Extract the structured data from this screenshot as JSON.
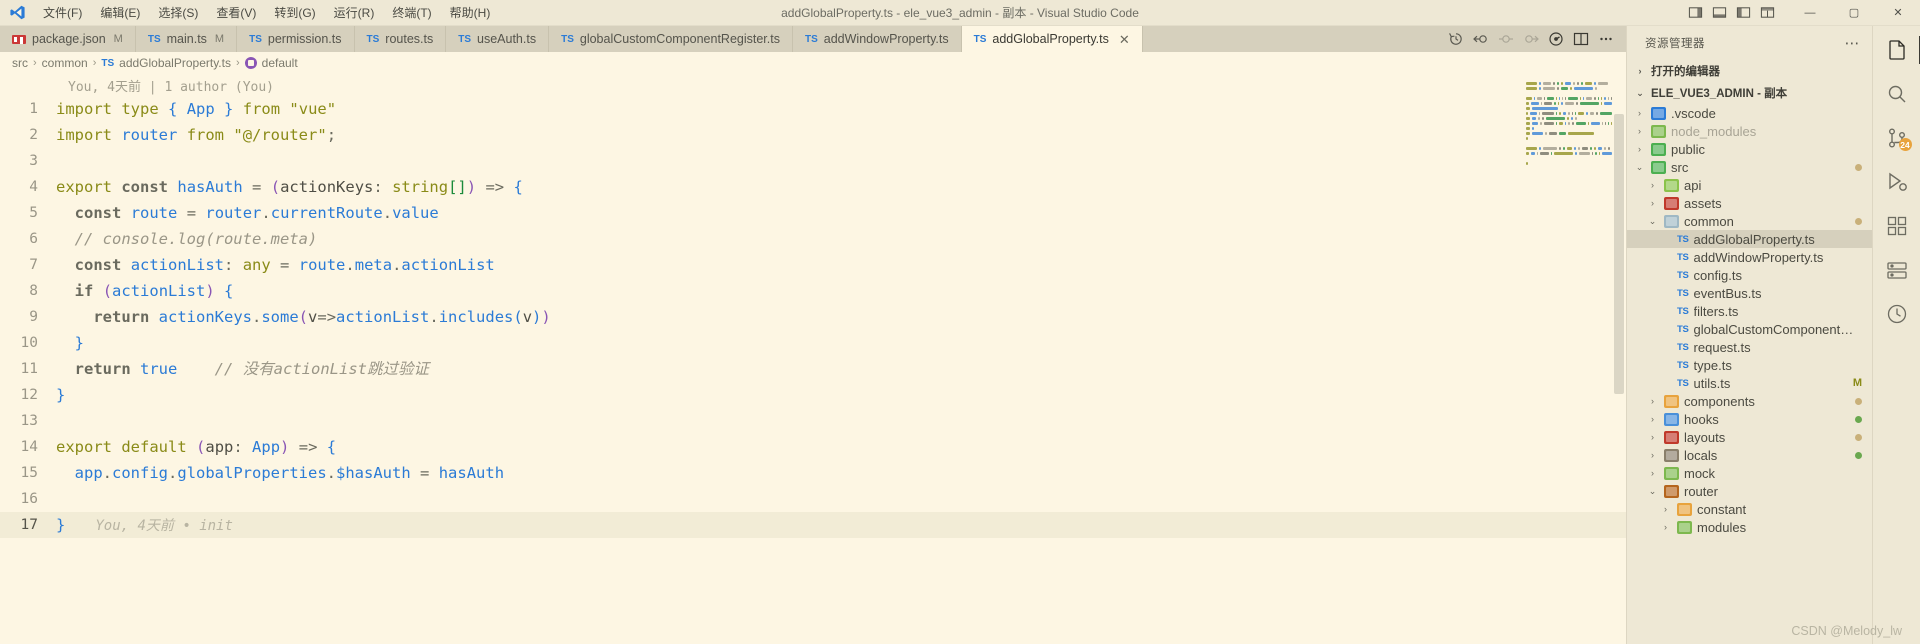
{
  "window": {
    "title": "addGlobalProperty.ts - ele_vue3_admin - 副本 - Visual Studio Code",
    "minimize": "—",
    "maximize": "▢",
    "close": "✕"
  },
  "menu": {
    "items": [
      {
        "label": "文件(F)"
      },
      {
        "label": "编辑(E)"
      },
      {
        "label": "选择(S)"
      },
      {
        "label": "查看(V)"
      },
      {
        "label": "转到(G)"
      },
      {
        "label": "运行(R)"
      },
      {
        "label": "终端(T)"
      },
      {
        "label": "帮助(H)"
      }
    ]
  },
  "tabs": [
    {
      "label": "package.json",
      "icon": "npm-icon",
      "dirty": "M",
      "active": false
    },
    {
      "label": "main.ts",
      "icon": "typescript-icon",
      "dirty": "M",
      "active": false
    },
    {
      "label": "permission.ts",
      "icon": "typescript-icon",
      "dirty": "",
      "active": false
    },
    {
      "label": "routes.ts",
      "icon": "typescript-icon",
      "dirty": "",
      "active": false
    },
    {
      "label": "useAuth.ts",
      "icon": "typescript-icon",
      "dirty": "",
      "active": false
    },
    {
      "label": "globalCustomComponentRegister.ts",
      "icon": "typescript-icon",
      "dirty": "",
      "active": false
    },
    {
      "label": "addWindowProperty.ts",
      "icon": "typescript-icon",
      "dirty": "",
      "active": false
    },
    {
      "label": "addGlobalProperty.ts",
      "icon": "typescript-icon",
      "dirty": "",
      "active": true,
      "close": "✕"
    }
  ],
  "editor_actions": [
    {
      "name": "timeline-history-icon"
    },
    {
      "name": "go-back-icon"
    },
    {
      "name": "nav-previous-icon"
    },
    {
      "name": "nav-next-icon"
    },
    {
      "name": "run-debug-icon"
    },
    {
      "name": "split-editor-icon"
    },
    {
      "name": "more-actions-icon"
    }
  ],
  "breadcrumb": {
    "parts": [
      "src",
      "common",
      "addGlobalProperty.ts",
      "default"
    ],
    "separator": "›"
  },
  "blame": {
    "text": "You, 4天前 | 1 author (You)",
    "inline_hint": "You, 4天前 • init"
  },
  "code": {
    "lines": [
      {
        "n": "1",
        "tokens": [
          {
            "t": "import",
            "c": "t-kw"
          },
          {
            "t": " ",
            "c": "t-plain"
          },
          {
            "t": "type",
            "c": "t-kw"
          },
          {
            "t": " ",
            "c": "t-plain"
          },
          {
            "t": "{",
            "c": "t-paren2"
          },
          {
            "t": " ",
            "c": "t-plain"
          },
          {
            "t": "App",
            "c": "t-type"
          },
          {
            "t": " ",
            "c": "t-plain"
          },
          {
            "t": "}",
            "c": "t-paren2"
          },
          {
            "t": " ",
            "c": "t-plain"
          },
          {
            "t": "from",
            "c": "t-kw"
          },
          {
            "t": " ",
            "c": "t-plain"
          },
          {
            "t": "\"vue\"",
            "c": "t-str"
          }
        ]
      },
      {
        "n": "2",
        "tokens": [
          {
            "t": "import",
            "c": "t-kw"
          },
          {
            "t": " ",
            "c": "t-plain"
          },
          {
            "t": "router",
            "c": "t-var"
          },
          {
            "t": " ",
            "c": "t-plain"
          },
          {
            "t": "from",
            "c": "t-kw"
          },
          {
            "t": " ",
            "c": "t-plain"
          },
          {
            "t": "\"@/router\"",
            "c": "t-str"
          },
          {
            "t": ";",
            "c": "t-punct"
          }
        ]
      },
      {
        "n": "3",
        "tokens": []
      },
      {
        "n": "4",
        "tokens": [
          {
            "t": "export",
            "c": "t-kw"
          },
          {
            "t": " ",
            "c": "t-plain"
          },
          {
            "t": "const",
            "c": "t-kw2"
          },
          {
            "t": " ",
            "c": "t-plain"
          },
          {
            "t": "hasAuth",
            "c": "t-fn"
          },
          {
            "t": " ",
            "c": "t-plain"
          },
          {
            "t": "=",
            "c": "t-op"
          },
          {
            "t": " ",
            "c": "t-plain"
          },
          {
            "t": "(",
            "c": "t-paren1"
          },
          {
            "t": "actionKeys",
            "c": "t-plain"
          },
          {
            "t": ":",
            "c": "t-punct"
          },
          {
            "t": " ",
            "c": "t-plain"
          },
          {
            "t": "string",
            "c": "t-kw"
          },
          {
            "t": "[]",
            "c": "t-brack"
          },
          {
            "t": ")",
            "c": "t-paren1"
          },
          {
            "t": " ",
            "c": "t-plain"
          },
          {
            "t": "=>",
            "c": "t-op"
          },
          {
            "t": " ",
            "c": "t-plain"
          },
          {
            "t": "{",
            "c": "t-paren2"
          }
        ]
      },
      {
        "n": "5",
        "tokens": [
          {
            "t": "  ",
            "c": "t-plain"
          },
          {
            "t": "const",
            "c": "t-kw2"
          },
          {
            "t": " ",
            "c": "t-plain"
          },
          {
            "t": "route",
            "c": "t-var"
          },
          {
            "t": " ",
            "c": "t-plain"
          },
          {
            "t": "=",
            "c": "t-op"
          },
          {
            "t": " ",
            "c": "t-plain"
          },
          {
            "t": "router",
            "c": "t-var"
          },
          {
            "t": ".",
            "c": "t-punct"
          },
          {
            "t": "currentRoute",
            "c": "t-var"
          },
          {
            "t": ".",
            "c": "t-punct"
          },
          {
            "t": "value",
            "c": "t-var"
          }
        ]
      },
      {
        "n": "6",
        "tokens": [
          {
            "t": "  ",
            "c": "t-plain"
          },
          {
            "t": "// console.log(route.meta)",
            "c": "t-cmt"
          }
        ]
      },
      {
        "n": "7",
        "tokens": [
          {
            "t": "  ",
            "c": "t-plain"
          },
          {
            "t": "const",
            "c": "t-kw2"
          },
          {
            "t": " ",
            "c": "t-plain"
          },
          {
            "t": "actionList",
            "c": "t-var"
          },
          {
            "t": ":",
            "c": "t-punct"
          },
          {
            "t": " ",
            "c": "t-plain"
          },
          {
            "t": "any",
            "c": "t-kw"
          },
          {
            "t": " ",
            "c": "t-plain"
          },
          {
            "t": "=",
            "c": "t-op"
          },
          {
            "t": " ",
            "c": "t-plain"
          },
          {
            "t": "route",
            "c": "t-var"
          },
          {
            "t": ".",
            "c": "t-punct"
          },
          {
            "t": "meta",
            "c": "t-var"
          },
          {
            "t": ".",
            "c": "t-punct"
          },
          {
            "t": "actionList",
            "c": "t-var"
          }
        ]
      },
      {
        "n": "8",
        "tokens": [
          {
            "t": "  ",
            "c": "t-plain"
          },
          {
            "t": "if",
            "c": "t-kw2"
          },
          {
            "t": " ",
            "c": "t-plain"
          },
          {
            "t": "(",
            "c": "t-paren1"
          },
          {
            "t": "actionList",
            "c": "t-var"
          },
          {
            "t": ")",
            "c": "t-paren1"
          },
          {
            "t": " ",
            "c": "t-plain"
          },
          {
            "t": "{",
            "c": "t-paren2"
          }
        ]
      },
      {
        "n": "9",
        "tokens": [
          {
            "t": "    ",
            "c": "t-plain"
          },
          {
            "t": "return",
            "c": "t-kw2"
          },
          {
            "t": " ",
            "c": "t-plain"
          },
          {
            "t": "actionKeys",
            "c": "t-var"
          },
          {
            "t": ".",
            "c": "t-punct"
          },
          {
            "t": "some",
            "c": "t-fn"
          },
          {
            "t": "(",
            "c": "t-paren1"
          },
          {
            "t": "v",
            "c": "t-plain"
          },
          {
            "t": "=>",
            "c": "t-op"
          },
          {
            "t": "actionList",
            "c": "t-var"
          },
          {
            "t": ".",
            "c": "t-punct"
          },
          {
            "t": "includes",
            "c": "t-fn"
          },
          {
            "t": "(",
            "c": "t-paren2"
          },
          {
            "t": "v",
            "c": "t-plain"
          },
          {
            "t": ")",
            "c": "t-paren2"
          },
          {
            "t": ")",
            "c": "t-paren1"
          }
        ]
      },
      {
        "n": "10",
        "tokens": [
          {
            "t": "  ",
            "c": "t-plain"
          },
          {
            "t": "}",
            "c": "t-paren2"
          }
        ]
      },
      {
        "n": "11",
        "tokens": [
          {
            "t": "  ",
            "c": "t-plain"
          },
          {
            "t": "return",
            "c": "t-kw2"
          },
          {
            "t": " ",
            "c": "t-plain"
          },
          {
            "t": "true",
            "c": "t-type"
          },
          {
            "t": "    ",
            "c": "t-plain"
          },
          {
            "t": "// 没有actionList跳过验证",
            "c": "t-cmt"
          }
        ]
      },
      {
        "n": "12",
        "tokens": [
          {
            "t": "}",
            "c": "t-paren2"
          }
        ]
      },
      {
        "n": "13",
        "tokens": []
      },
      {
        "n": "14",
        "tokens": [
          {
            "t": "export",
            "c": "t-kw"
          },
          {
            "t": " ",
            "c": "t-plain"
          },
          {
            "t": "default",
            "c": "t-kw"
          },
          {
            "t": " ",
            "c": "t-plain"
          },
          {
            "t": "(",
            "c": "t-paren1"
          },
          {
            "t": "app",
            "c": "t-plain"
          },
          {
            "t": ":",
            "c": "t-punct"
          },
          {
            "t": " ",
            "c": "t-plain"
          },
          {
            "t": "App",
            "c": "t-type"
          },
          {
            "t": ")",
            "c": "t-paren1"
          },
          {
            "t": " ",
            "c": "t-plain"
          },
          {
            "t": "=>",
            "c": "t-op"
          },
          {
            "t": " ",
            "c": "t-plain"
          },
          {
            "t": "{",
            "c": "t-paren2"
          }
        ]
      },
      {
        "n": "15",
        "tokens": [
          {
            "t": "  ",
            "c": "t-plain"
          },
          {
            "t": "app",
            "c": "t-var"
          },
          {
            "t": ".",
            "c": "t-punct"
          },
          {
            "t": "config",
            "c": "t-var"
          },
          {
            "t": ".",
            "c": "t-punct"
          },
          {
            "t": "globalProperties",
            "c": "t-var"
          },
          {
            "t": ".",
            "c": "t-punct"
          },
          {
            "t": "$hasAuth",
            "c": "t-fn"
          },
          {
            "t": " ",
            "c": "t-plain"
          },
          {
            "t": "=",
            "c": "t-op"
          },
          {
            "t": " ",
            "c": "t-plain"
          },
          {
            "t": "hasAuth",
            "c": "t-fn"
          }
        ]
      },
      {
        "n": "16",
        "tokens": []
      },
      {
        "n": "17",
        "tokens": [
          {
            "t": "}",
            "c": "t-paren2"
          }
        ],
        "current": true
      }
    ]
  },
  "sidebar": {
    "title": "资源管理器",
    "more": "⋯",
    "open_editors": {
      "label": "打开的编辑器",
      "chevron": "›"
    },
    "project": {
      "label": "ELE_VUE3_ADMIN - 副本",
      "chevron": "⌄"
    },
    "tree": [
      {
        "label": ".vscode",
        "indent": 1,
        "chevron": "›",
        "kind": "folder",
        "color": "#2b7bd6",
        "dimmed": false,
        "badge": "",
        "dot": ""
      },
      {
        "label": "node_modules",
        "indent": 1,
        "chevron": "›",
        "kind": "folder",
        "color": "#7db84e",
        "dimmed": true,
        "badge": "",
        "dot": ""
      },
      {
        "label": "public",
        "indent": 1,
        "chevron": "›",
        "kind": "folder",
        "color": "#4caf50",
        "dimmed": false,
        "badge": "",
        "dot": ""
      },
      {
        "label": "src",
        "indent": 1,
        "chevron": "⌄",
        "kind": "folder",
        "color": "#4caf50",
        "dimmed": false,
        "badge": "",
        "dot": "#c9b079"
      },
      {
        "label": "api",
        "indent": 2,
        "chevron": "›",
        "kind": "folder",
        "color": "#8bc34a",
        "dimmed": false,
        "badge": "",
        "dot": ""
      },
      {
        "label": "assets",
        "indent": 2,
        "chevron": "›",
        "kind": "folder",
        "color": "#c0392b",
        "dimmed": false,
        "badge": "",
        "dot": ""
      },
      {
        "label": "common",
        "indent": 2,
        "chevron": "⌄",
        "kind": "folder",
        "color": "#9fb8c4",
        "dimmed": false,
        "badge": "",
        "dot": "#c9b079"
      },
      {
        "label": "addGlobalProperty.ts",
        "indent": 3,
        "chevron": "",
        "kind": "ts",
        "dimmed": false,
        "badge": "",
        "dot": "",
        "selected": true
      },
      {
        "label": "addWindowProperty.ts",
        "indent": 3,
        "chevron": "",
        "kind": "ts",
        "dimmed": false,
        "badge": "",
        "dot": ""
      },
      {
        "label": "config.ts",
        "indent": 3,
        "chevron": "",
        "kind": "ts",
        "dimmed": false,
        "badge": "",
        "dot": ""
      },
      {
        "label": "eventBus.ts",
        "indent": 3,
        "chevron": "",
        "kind": "ts",
        "dimmed": false,
        "badge": "",
        "dot": ""
      },
      {
        "label": "filters.ts",
        "indent": 3,
        "chevron": "",
        "kind": "ts",
        "dimmed": false,
        "badge": "",
        "dot": ""
      },
      {
        "label": "globalCustomComponentRegist…",
        "indent": 3,
        "chevron": "",
        "kind": "ts",
        "dimmed": false,
        "badge": "",
        "dot": ""
      },
      {
        "label": "request.ts",
        "indent": 3,
        "chevron": "",
        "kind": "ts",
        "dimmed": false,
        "badge": "",
        "dot": ""
      },
      {
        "label": "type.ts",
        "indent": 3,
        "chevron": "",
        "kind": "ts",
        "dimmed": false,
        "badge": "",
        "dot": ""
      },
      {
        "label": "utils.ts",
        "indent": 3,
        "chevron": "",
        "kind": "ts",
        "dimmed": false,
        "badge": "M",
        "badge_color": "#8a8b18",
        "dot": ""
      },
      {
        "label": "components",
        "indent": 2,
        "chevron": "›",
        "kind": "folder",
        "color": "#e8a33d",
        "dimmed": false,
        "badge": "",
        "dot": "#c9b079"
      },
      {
        "label": "hooks",
        "indent": 2,
        "chevron": "›",
        "kind": "folder",
        "color": "#4a90d9",
        "dimmed": false,
        "badge": "",
        "dot": "#6aa84f"
      },
      {
        "label": "layouts",
        "indent": 2,
        "chevron": "›",
        "kind": "folder",
        "color": "#c0392b",
        "dimmed": false,
        "badge": "",
        "dot": "#c9b079"
      },
      {
        "label": "locals",
        "indent": 2,
        "chevron": "›",
        "kind": "folder",
        "color": "#8a7f6b",
        "dimmed": false,
        "badge": "",
        "dot": "#6aa84f"
      },
      {
        "label": "mock",
        "indent": 2,
        "chevron": "›",
        "kind": "folder",
        "color": "#7db84e",
        "dimmed": false,
        "badge": "",
        "dot": ""
      },
      {
        "label": "router",
        "indent": 2,
        "chevron": "⌄",
        "kind": "folder",
        "color": "#b5651d",
        "dimmed": false,
        "badge": "",
        "dot": ""
      },
      {
        "label": "constant",
        "indent": 3,
        "chevron": "›",
        "kind": "folder",
        "color": "#e8a33d",
        "dimmed": false,
        "badge": "",
        "dot": ""
      },
      {
        "label": "modules",
        "indent": 3,
        "chevron": "›",
        "kind": "folder",
        "color": "#7db84e",
        "dimmed": false,
        "badge": "",
        "dot": ""
      }
    ]
  },
  "activitybar": {
    "items": [
      {
        "name": "explorer-icon",
        "active": true,
        "badge": ""
      },
      {
        "name": "search-icon",
        "active": false,
        "badge": ""
      },
      {
        "name": "source-control-icon",
        "active": false,
        "badge": "24"
      },
      {
        "name": "run-debug-icon",
        "active": false,
        "badge": ""
      },
      {
        "name": "extensions-icon",
        "active": false,
        "badge": ""
      },
      {
        "name": "remote-explorer-icon",
        "active": false,
        "badge": ""
      },
      {
        "name": "testing-icon",
        "active": false,
        "badge": ""
      }
    ]
  },
  "watermark": "CSDN @Melody_lw",
  "colors": {
    "accent": "#2b7bd6",
    "titlebar_bg": "#eee8d5",
    "tabbar_bg": "#d6d0bd",
    "editor_bg": "#fdf6e3",
    "sidebar_bg": "#eee8d5",
    "modified": "#8a8b18"
  }
}
